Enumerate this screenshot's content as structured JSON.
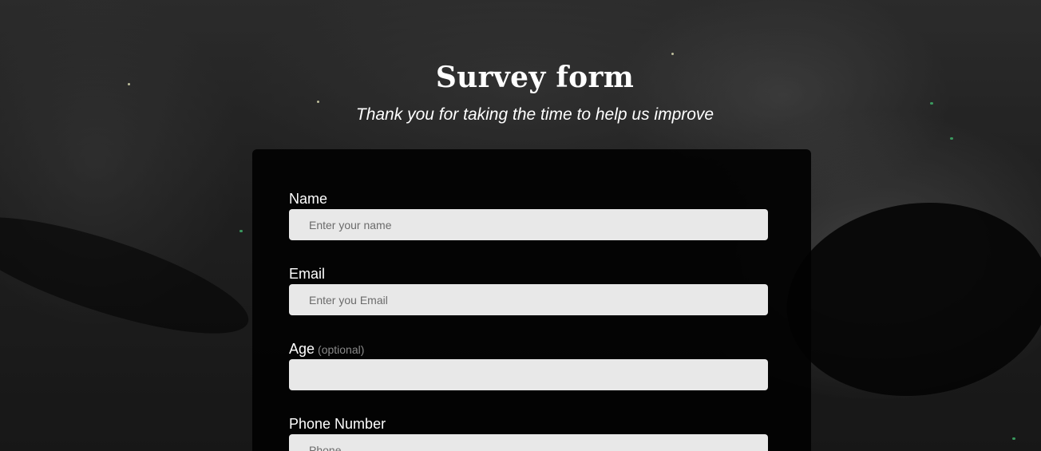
{
  "header": {
    "title": "Survey form",
    "description": "Thank you for taking the time to help us improve"
  },
  "form": {
    "name": {
      "label": "Name",
      "placeholder": "Enter your name",
      "value": ""
    },
    "email": {
      "label": "Email",
      "placeholder": "Enter you Email",
      "value": ""
    },
    "age": {
      "label": "Age",
      "optional_text": "(optional)",
      "placeholder": "",
      "value": ""
    },
    "phone": {
      "label": "Phone Number",
      "placeholder": "Phone",
      "value": ""
    }
  },
  "colors": {
    "card_background": "#020202",
    "input_background": "#e8e8e8",
    "text": "#ffffff",
    "optional_text": "#8a8a8a"
  }
}
